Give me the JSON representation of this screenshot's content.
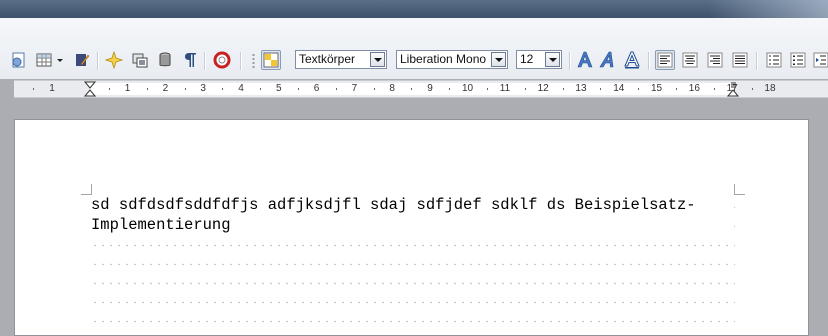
{
  "toolbar": {
    "paragraph_style": "Textkörper",
    "font_name": "Liberation Mono",
    "font_size": "12",
    "icons": [
      "document-icon",
      "table-icon",
      "table-dropdown-icon",
      "show-draw-functions-icon",
      "navigator-icon",
      "gallery-icon",
      "data-sources-icon",
      "formatting-marks-icon",
      "help-icon",
      "paragraph-styles-icon",
      "bold-a-icon",
      "italic-a-icon",
      "outline-a-icon",
      "align-left-icon",
      "align-center-icon",
      "align-right-icon",
      "justify-icon",
      "numbering-icon",
      "bullets-icon",
      "decrease-indent-icon"
    ]
  },
  "ruler": {
    "numbers": [
      "1",
      "1",
      "2",
      "3",
      "4",
      "5",
      "6",
      "7",
      "8",
      "9",
      "10",
      "11",
      "12",
      "13",
      "14",
      "15",
      "16",
      "17",
      "18"
    ]
  },
  "document": {
    "text": "sd sdfdsdfsddfdfjs adfjksdjfl sdaj sdfjdef sdklf ds Beispielsatz-Implementierung"
  }
}
